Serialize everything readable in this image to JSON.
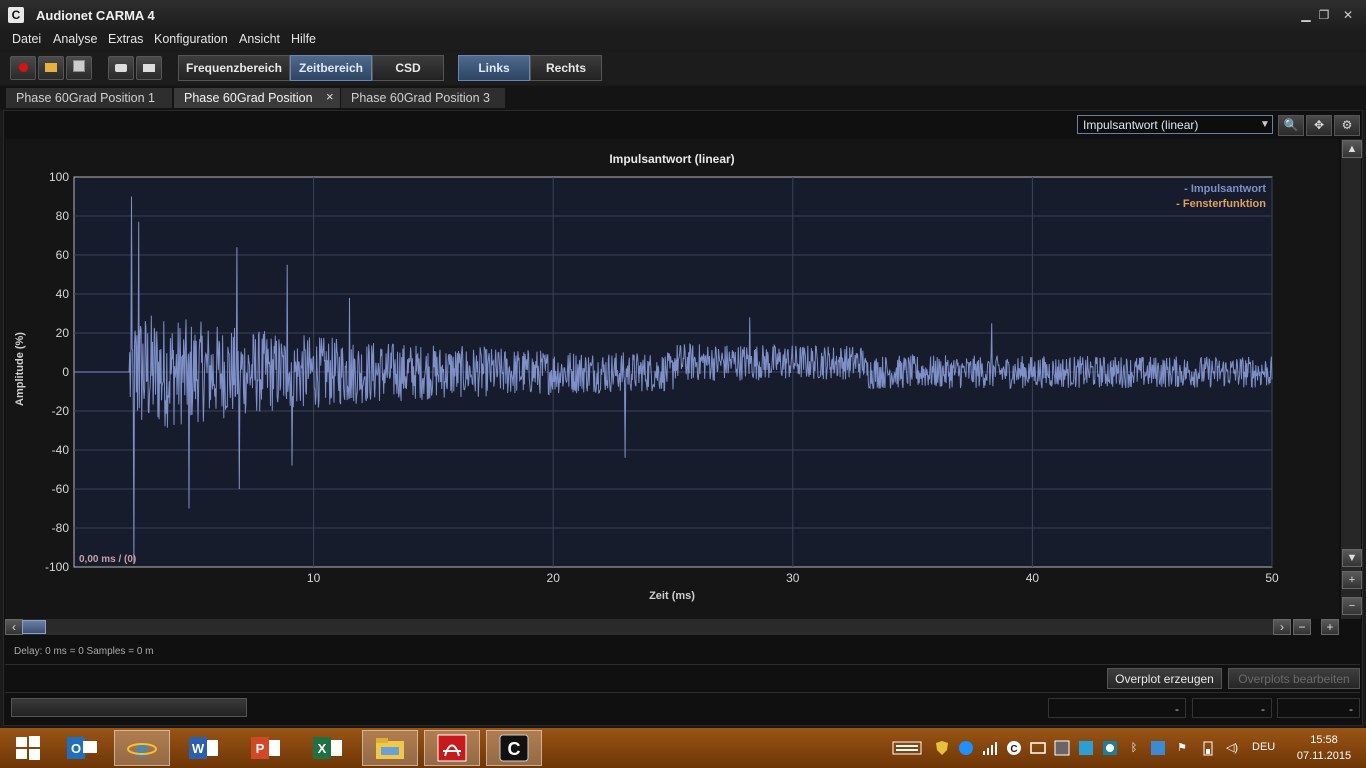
{
  "window": {
    "app_icon_letter": "C",
    "title": "Audionet CARMA 4",
    "min_glyph": "▁",
    "restore_glyph": "❐",
    "close_glyph": "✕"
  },
  "menu": [
    "Datei",
    "Analyse",
    "Extras",
    "Konfiguration",
    "Ansicht",
    "Hilfe"
  ],
  "toolbar": {
    "icons": [
      "record-icon",
      "open-folder-icon",
      "save-icon",
      "camera-icon",
      "print-icon"
    ],
    "view_buttons": [
      {
        "label": "Frequenzbereich",
        "active": false
      },
      {
        "label": "Zeitbereich",
        "active": true
      },
      {
        "label": "CSD",
        "active": false
      }
    ],
    "channel_buttons": [
      {
        "label": "Links",
        "active": true
      },
      {
        "label": "Rechts",
        "active": false
      }
    ]
  },
  "tabs": [
    {
      "label": "Phase 60Grad Position 1",
      "active": false
    },
    {
      "label": "Phase 60Grad Position 2",
      "active": true,
      "close": "×"
    },
    {
      "label": "Phase 60Grad Position 3",
      "active": false
    }
  ],
  "view_select": {
    "value": "Impulsantwort (linear)"
  },
  "right_tools": [
    "zoom-icon",
    "move-icon",
    "settings-icon"
  ],
  "cursor_readout": "0,00 ms / (0)",
  "delay_text": "Delay: 0 ms = 0 Samples = 0 m",
  "overplot": {
    "create": "Overplot erzeugen",
    "edit": "Overplots bearbeiten"
  },
  "status_fields": [
    "-",
    "-",
    "-"
  ],
  "taskbar": {
    "apps": [
      "windows-start-icon",
      "outlook-icon",
      "internet-explorer-icon",
      "word-icon",
      "powerpoint-icon",
      "excel-icon",
      "file-explorer-icon",
      "acrobat-icon",
      "carma-icon"
    ],
    "language": "DEU",
    "time": "15:58",
    "date": "07.11.2015"
  },
  "colors": {
    "impulse": "#7f8fc8",
    "window_fn": "#e0a060",
    "accent": "#4e6a8e"
  },
  "chart_data": {
    "type": "line",
    "title": "Impulsantwort (linear)",
    "xlabel": "Zeit (ms)",
    "ylabel": "Amplitude (%)",
    "xlim": [
      0,
      50
    ],
    "ylim": [
      -100,
      100
    ],
    "xticks": [
      10,
      20,
      30,
      40,
      50
    ],
    "yticks": [
      100,
      80,
      60,
      40,
      20,
      0,
      -20,
      -40,
      -60,
      -80,
      -100
    ],
    "grid": true,
    "legend_position": "top-right",
    "series": [
      {
        "name": "- Impulsantwort",
        "color": "#7f8fc8"
      },
      {
        "name": "- Fensterfunktion",
        "color": "#e0a060"
      }
    ],
    "peaks": [
      {
        "x": 2.4,
        "y": 90
      },
      {
        "x": 2.5,
        "y": -98
      },
      {
        "x": 2.7,
        "y": 77
      },
      {
        "x": 4.8,
        "y": -70
      },
      {
        "x": 6.8,
        "y": 64
      },
      {
        "x": 6.9,
        "y": -60
      },
      {
        "x": 8.9,
        "y": 55
      },
      {
        "x": 9.1,
        "y": -48
      },
      {
        "x": 11.5,
        "y": 38
      },
      {
        "x": 23.0,
        "y": -44
      },
      {
        "x": 28.2,
        "y": 28
      },
      {
        "x": 38.3,
        "y": 25
      }
    ]
  }
}
